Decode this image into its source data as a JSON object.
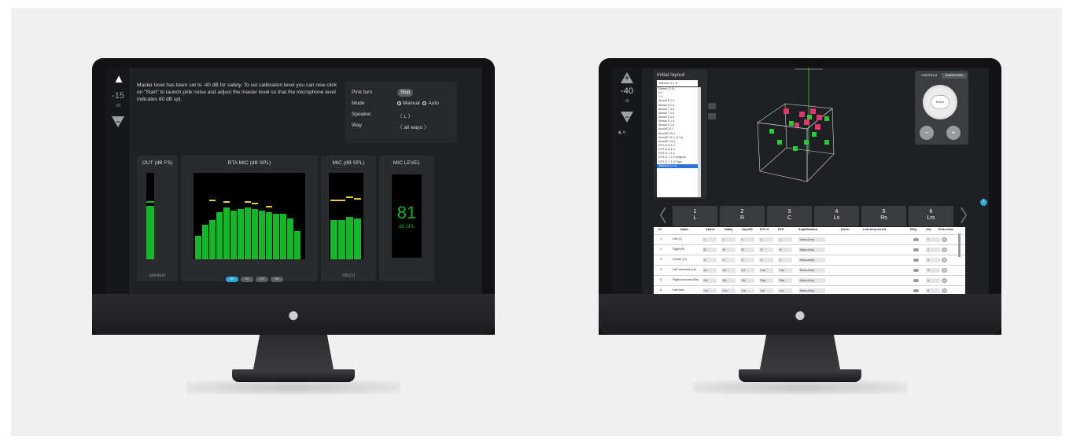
{
  "left_screen": {
    "volume": "-15",
    "volume_unit": "dB",
    "message": "Master level has been set to -40 dB for safety. To set calibration level you can now click on \"Start\" to launch pink noise and adjust the master level so that the microphone level indicates 80 dB spl.",
    "pink_turn_label": "Pink turn",
    "pink_turn_button": "Stop",
    "mode_label": "Mode",
    "mode_manual": "Manual",
    "mode_auto": "Auto",
    "speaker_label": "Speaker",
    "speaker_value": "〈  L  〉",
    "way_label": "Way",
    "way_value": "〈  all ways  〉",
    "out_title": "OUT (dB FS)",
    "out_footer": "speaker",
    "rta_title": "RTA MIC (dB SPL)",
    "mic_title": "MIC (dB SPL)",
    "mic_footer": "mic(s)",
    "miclevel_title": "MIC LEVEL",
    "mic_level_value": "81",
    "mic_level_unit": "dB SPL",
    "chips": [
      "M1",
      "M2",
      "M3",
      "M4"
    ],
    "accent": "#2aa7d6",
    "meter_green": "#16b52a"
  },
  "right_screen": {
    "volume": "-40",
    "volume_unit": "dB",
    "initial_layout_title": "Initial layout:",
    "selected_layout": "Triinnov 9.1.6",
    "layout_options": [
      "Stereo (2.0)",
      "5.1",
      "7.1",
      "Atmos 5.1.2",
      "Atmos 5.1.4",
      "Atmos 7.1.2",
      "Atmos 7.1.4",
      "Atmos 9.1.2",
      "Atmos 9.1.4",
      "Atmos 9.1.6",
      "Auro3D 9.1",
      "Auro3D 10.1",
      "Auro3D 11.1 (7+4)",
      "Auro3D 13.1",
      "DTS:X 5.1.2",
      "DTS:X 5.1.4",
      "DTS:X 7.1.2",
      "DTS:X 7.1.4 Heights",
      "DTS:X 7.1.4 Tops",
      "Triinnov 9.1.6"
    ],
    "controls_tab": "CONTROLS",
    "dimensions_tab": "DIMENSIONS",
    "reset_label": "Reset",
    "speakers": [
      {
        "num": "1",
        "code": "L"
      },
      {
        "num": "2",
        "code": "R"
      },
      {
        "num": "3",
        "code": "C"
      },
      {
        "num": "4",
        "code": "Ls"
      },
      {
        "num": "5",
        "code": "Rs"
      },
      {
        "num": "6",
        "code": "Lrs"
      }
    ],
    "table_headers": [
      "N°",
      "Name",
      "Atmos",
      "Dolby",
      "Auro3D",
      "DTS:X",
      "DTS",
      "Amplification",
      "Driver",
      "Low-freq cut-off",
      "PEQ",
      "Out",
      "Pink noise"
    ],
    "rows": [
      {
        "n": "1",
        "name": "Left (L)",
        "atmos": "L",
        "dolby": "L",
        "auro": "L",
        "dtsx": "L",
        "dts": "L",
        "amp": "Mono-Amp",
        "out": "1"
      },
      {
        "n": "2",
        "name": "Right (R)",
        "atmos": "R",
        "dolby": "R",
        "auro": "R",
        "dtsx": "R",
        "dts": "R",
        "amp": "Mono-Amp",
        "out": "2"
      },
      {
        "n": "3",
        "name": "Center (C)",
        "atmos": "C",
        "dolby": "C",
        "auro": "C",
        "dtsx": "C",
        "dts": "C",
        "amp": "Mono-Amp",
        "out": "3"
      },
      {
        "n": "4",
        "name": "Left surround (Ls)",
        "atmos": "Ls",
        "dolby": "Ls",
        "auro": "Ls",
        "dtsx": "Lss",
        "dts": "Lss",
        "amp": "Mono-Amp",
        "out": "4"
      },
      {
        "n": "5",
        "name": "Right surround (Rs)",
        "atmos": "Rs",
        "dolby": "Rs",
        "auro": "Rs",
        "dtsx": "Rss",
        "dts": "Rss",
        "amp": "Mono-Amp",
        "out": "5"
      },
      {
        "n": "6",
        "name": "Left rear",
        "atmos": "Lrs",
        "dolby": "Lrs",
        "auro": "Lrs",
        "dtsx": "Lsr",
        "dts": "Lsr",
        "amp": "Mono-Amp",
        "out": "6"
      }
    ]
  }
}
